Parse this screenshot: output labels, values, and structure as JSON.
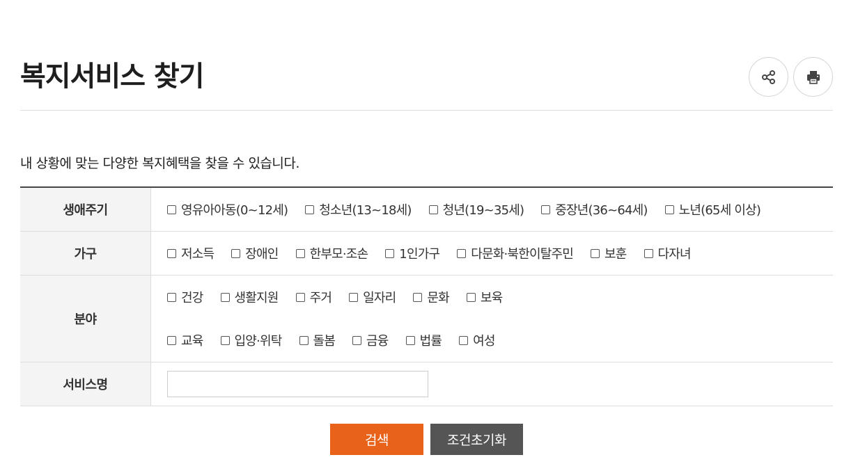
{
  "header": {
    "title": "복지서비스 찾기",
    "share_icon": "share-icon",
    "print_icon": "printer-icon"
  },
  "intro": "내 상황에 맞는 다양한 복지혜택을 찾을 수 있습니다.",
  "filters": {
    "life_cycle": {
      "label": "생애주기",
      "options": [
        "영유아아동(0~12세)",
        "청소년(13~18세)",
        "청년(19~35세)",
        "중장년(36~64세)",
        "노년(65세 이상)"
      ]
    },
    "household": {
      "label": "가구",
      "options": [
        "저소득",
        "장애인",
        "한부모·조손",
        "1인가구",
        "다문화·북한이탈주민",
        "보훈",
        "다자녀"
      ]
    },
    "field": {
      "label": "분야",
      "options_row1": [
        "건강",
        "생활지원",
        "주거",
        "일자리",
        "문화",
        "보육"
      ],
      "options_row2": [
        "교육",
        "입양·위탁",
        "돌봄",
        "금융",
        "법률",
        "여성"
      ]
    },
    "service_name": {
      "label": "서비스명",
      "value": "",
      "placeholder": ""
    }
  },
  "buttons": {
    "search": "검색",
    "reset": "조건초기화"
  },
  "colors": {
    "search_button": "#e8621a",
    "reset_button": "#555555",
    "label_bg": "#f4f4f4"
  }
}
